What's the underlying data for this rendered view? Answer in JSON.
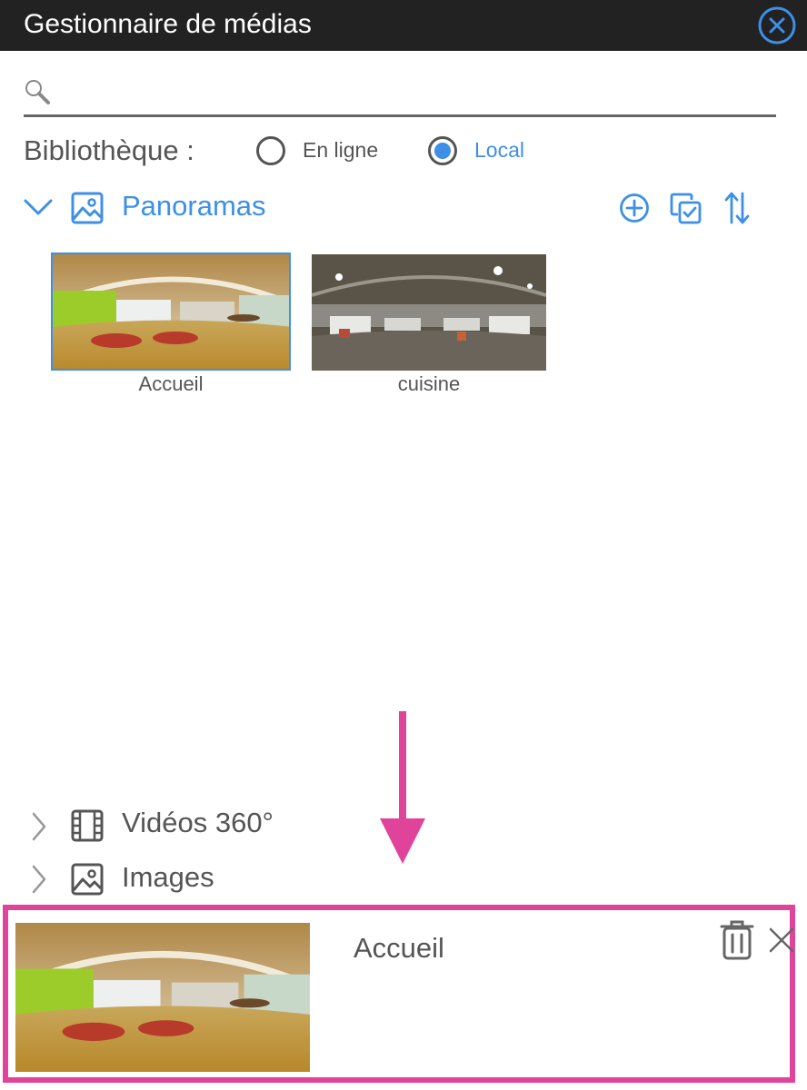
{
  "window": {
    "title": "Gestionnaire de médias"
  },
  "search": {
    "placeholder": "",
    "value": ""
  },
  "library": {
    "label": "Bibliothèque :",
    "options": [
      {
        "label": "En ligne",
        "checked": false
      },
      {
        "label": "Local",
        "checked": true
      }
    ]
  },
  "sections": {
    "panoramas": {
      "title": "Panoramas",
      "expanded": true
    },
    "videos": {
      "title": "Vidéos 360°",
      "expanded": false
    },
    "images": {
      "title": "Images",
      "expanded": false
    }
  },
  "panoramas": [
    {
      "name": "Accueil",
      "selected": true
    },
    {
      "name": "cuisine",
      "selected": false
    }
  ],
  "selection": {
    "name": "Accueil"
  },
  "colors": {
    "accent": "#3d8fe8",
    "highlight": "#e0439a",
    "titlebar": "#222222"
  },
  "icons": [
    "close-icon",
    "search-icon",
    "chevron-down-icon",
    "image-icon",
    "add-icon",
    "select-all-icon",
    "sort-icon",
    "chevron-right-icon",
    "film-icon",
    "trash-icon",
    "close-x-icon"
  ]
}
